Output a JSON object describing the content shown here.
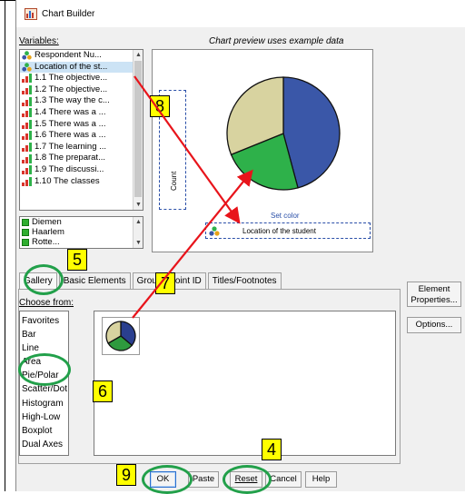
{
  "window": {
    "title": "Chart Builder"
  },
  "labels": {
    "variables": "Variables:",
    "preview_note": "Chart preview uses example data",
    "choose_from": "Choose from:"
  },
  "variables": [
    {
      "label": "Respondent Nu...",
      "icon": "nominal-icon"
    },
    {
      "label": "Location of the st...",
      "icon": "nominal-icon",
      "selected": true
    },
    {
      "label": "1.1 The objective...",
      "icon": "ordinal-icon"
    },
    {
      "label": "1.2 The objective...",
      "icon": "ordinal-icon"
    },
    {
      "label": "1.3 The way the c...",
      "icon": "ordinal-icon"
    },
    {
      "label": "1.4 There was a ...",
      "icon": "ordinal-icon"
    },
    {
      "label": "1.5 There was a ...",
      "icon": "ordinal-icon"
    },
    {
      "label": "1.6 There was a ...",
      "icon": "ordinal-icon"
    },
    {
      "label": "1.7 The learning ...",
      "icon": "ordinal-icon"
    },
    {
      "label": "1.8 The preparat...",
      "icon": "ordinal-icon"
    },
    {
      "label": "1.9 The discussi...",
      "icon": "ordinal-icon"
    },
    {
      "label": "1.10 The classes",
      "icon": "ordinal-icon"
    }
  ],
  "categories": [
    "Diemen",
    "Haarlem",
    "Rotte..."
  ],
  "preview": {
    "y_label": "Count",
    "set_color": "Set color",
    "x_label": "Location of the student",
    "colors": {
      "blue": "#3a57a8",
      "green": "#2eb14a",
      "tan": "#d8d3a0"
    }
  },
  "tabs": [
    "Gallery",
    "Basic Elements",
    "Groups/Point ID",
    "Titles/Footnotes"
  ],
  "chart_types": [
    "Favorites",
    "Bar",
    "Line",
    "Area",
    "Pie/Polar",
    "Scatter/Dot",
    "Histogram",
    "High-Low",
    "Boxplot",
    "Dual Axes"
  ],
  "side_buttons": {
    "element_properties": "Element Properties...",
    "options": "Options..."
  },
  "buttons": {
    "ok": "OK",
    "paste": "Paste",
    "reset": "Reset",
    "cancel": "Cancel",
    "help": "Help"
  },
  "badges": {
    "b4": "4",
    "b5": "5",
    "b6": "6",
    "b7": "7",
    "b8": "8",
    "b9": "9"
  },
  "annotation_colors": {
    "badge": "#ffff00",
    "ring": "#22a04a",
    "arrow": "#e8141b"
  }
}
